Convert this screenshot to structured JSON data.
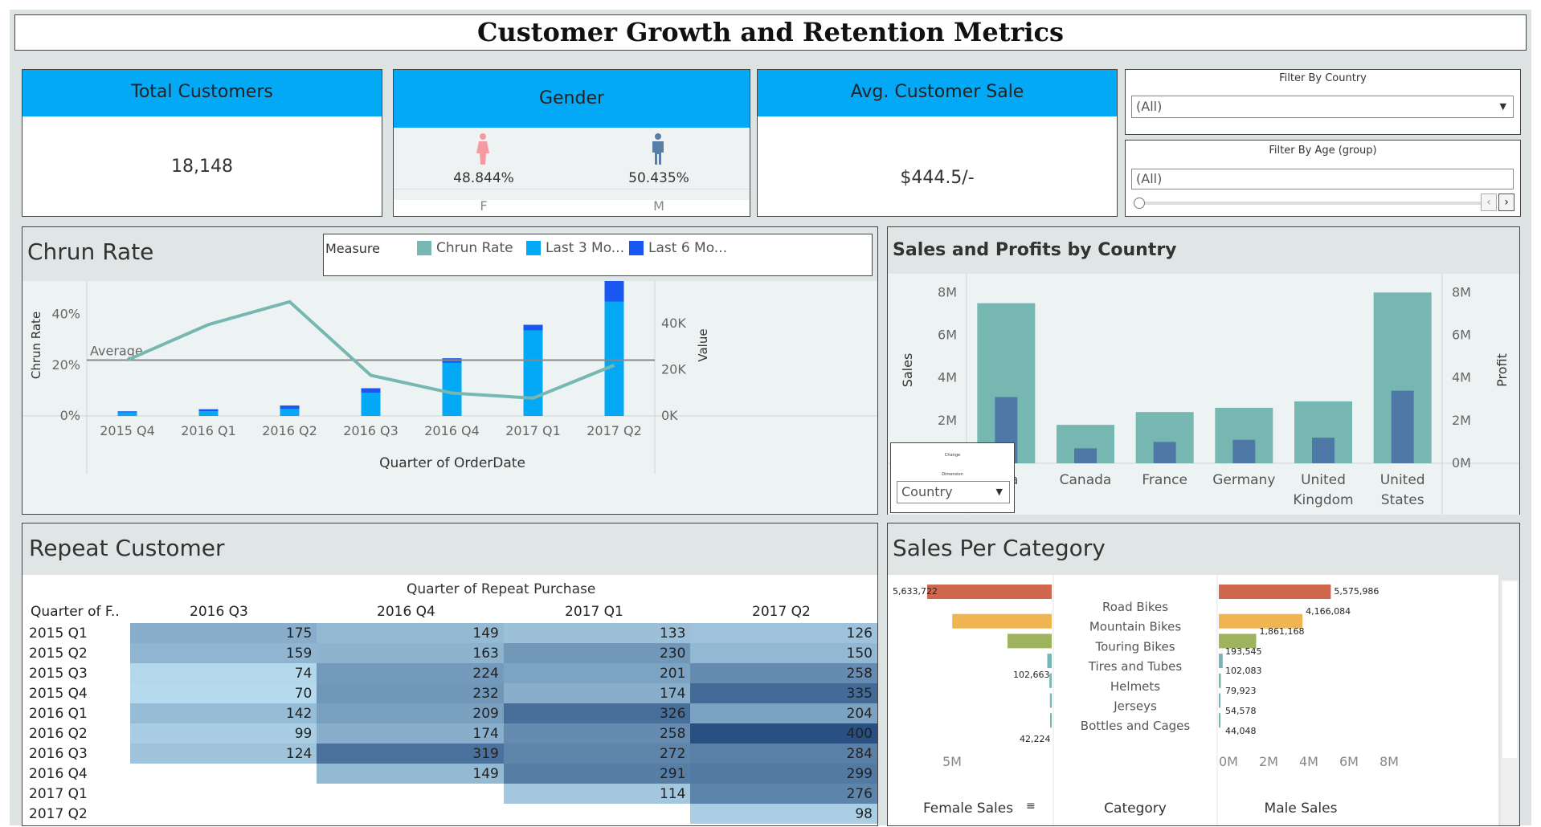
{
  "title": "Customer Growth and Retention Metrics",
  "kpis": {
    "total_customers": {
      "label": "Total Customers",
      "value": "18,148"
    },
    "gender": {
      "label": "Gender",
      "female_pct": "48.844%",
      "male_pct": "50.435%",
      "female_code": "F",
      "male_code": "M",
      "female_icon": "female-person-icon",
      "male_icon": "male-person-icon"
    },
    "avg_sale": {
      "label": "Avg. Customer Sale",
      "value": "$444.5/-"
    }
  },
  "filters": {
    "country": {
      "label": "Filter By Country",
      "value": "(All)"
    },
    "age": {
      "label": "Filter By Age (group)",
      "value": "(All)"
    }
  },
  "colors": {
    "accent": "#03a9f4",
    "teal": "#76b7b2",
    "last3": "#03a9f4",
    "last6": "#1a56f0",
    "dark_blue": "#4e79a7",
    "road": "#d0684f",
    "mountain": "#f0b550",
    "touring": "#9fb35f"
  },
  "churn": {
    "title": "Chrun Rate",
    "legend_title": "Measure",
    "legend": [
      "Chrun Rate",
      "Last 3 Mo...",
      "Last 6 Mo..."
    ],
    "average_label": "Average",
    "y_left_label": "Chrun Rate",
    "y_right_label": "Value",
    "x_label": "Quarter of OrderDate",
    "left_ticks": [
      "40%",
      "20%",
      "0%"
    ],
    "right_ticks": [
      "40K",
      "20K",
      "0K"
    ]
  },
  "sales_country": {
    "title": "Sales and Profits by Country",
    "y_left_label": "Sales",
    "y_right_label": "Profit",
    "left_ticks": [
      "8M",
      "6M",
      "4M",
      "2M"
    ],
    "right_ticks": [
      "8M",
      "6M",
      "4M",
      "2M",
      "0M"
    ],
    "x_labels": [
      "alia",
      "Canada",
      "France",
      "Germany",
      "United Kingdom",
      "United States"
    ],
    "popup": {
      "line1": "Change",
      "line2": "Dimension",
      "value": "Country"
    }
  },
  "repeat": {
    "title": "Repeat Customer",
    "col_title": "Quarter of Repeat Purchase",
    "row_header": "Quarter of F..",
    "columns": [
      "2016 Q3",
      "2016 Q4",
      "2017 Q1",
      "2017 Q2"
    ],
    "rows": [
      {
        "label": "2015 Q1",
        "cells": [
          "175",
          "149",
          "133",
          "126"
        ]
      },
      {
        "label": "2015 Q2",
        "cells": [
          "159",
          "163",
          "230",
          "150"
        ]
      },
      {
        "label": "2015 Q3",
        "cells": [
          "74",
          "224",
          "201",
          "258"
        ]
      },
      {
        "label": "2015 Q4",
        "cells": [
          "70",
          "232",
          "174",
          "335"
        ]
      },
      {
        "label": "2016 Q1",
        "cells": [
          "142",
          "209",
          "326",
          "204"
        ]
      },
      {
        "label": "2016 Q2",
        "cells": [
          "99",
          "174",
          "258",
          "400"
        ]
      },
      {
        "label": "2016 Q3",
        "cells": [
          "124",
          "319",
          "272",
          "284"
        ]
      },
      {
        "label": "2016 Q4",
        "cells": [
          "",
          "149",
          "291",
          "299"
        ]
      },
      {
        "label": "2017 Q1",
        "cells": [
          "",
          "",
          "114",
          "276"
        ]
      },
      {
        "label": "2017 Q2",
        "cells": [
          "",
          "",
          "",
          "98"
        ]
      }
    ]
  },
  "category": {
    "title": "Sales Per Category",
    "female_label": "Female Sales",
    "category_label": "Category",
    "male_label": "Male Sales",
    "female_axis_tick": "5M",
    "male_axis_ticks": [
      "0M",
      "2M",
      "4M",
      "6M",
      "8M"
    ],
    "categories": [
      "Road Bikes",
      "Mountain Bikes",
      "Touring Bikes",
      "Tires and Tubes",
      "Helmets",
      "Jerseys",
      "Bottles and Cages"
    ],
    "female_labels": [
      "5,633,722",
      "102,663",
      "42,224"
    ],
    "male_labels": [
      "5,575,986",
      "4,166,084",
      "1,861,168",
      "193,545",
      "102,083",
      "79,923",
      "54,578",
      "44,048"
    ]
  },
  "chart_data": [
    {
      "type": "line",
      "title": "Chrun Rate",
      "xlabel": "Quarter of OrderDate",
      "ylabel": "Chrun Rate",
      "y2label": "Value",
      "x": [
        "2015 Q4",
        "2016 Q1",
        "2016 Q2",
        "2016 Q3",
        "2016 Q4",
        "2017 Q1",
        "2017 Q2"
      ],
      "ylim": [
        0,
        50
      ],
      "y2lim": [
        0,
        55000
      ],
      "average": 22,
      "series": [
        {
          "name": "Chrun Rate",
          "kind": "line",
          "axis": "left",
          "values": [
            22,
            36,
            45,
            16,
            9,
            7,
            20
          ]
        },
        {
          "name": "Last 3 Mo...",
          "kind": "bar",
          "axis": "right",
          "values": [
            1500,
            2000,
            3000,
            10000,
            23000,
            37000,
            49500
          ]
        },
        {
          "name": "Last 6 Mo...",
          "kind": "bar",
          "axis": "right",
          "values": [
            500,
            900,
            1500,
            2000,
            2000,
            2500,
            11000
          ]
        }
      ]
    },
    {
      "type": "bar",
      "title": "Sales and Profits by Country",
      "categories": [
        "Australia",
        "Canada",
        "France",
        "Germany",
        "United Kingdom",
        "United States"
      ],
      "ylabel": "Sales",
      "y2label": "Profit",
      "ylim": [
        0,
        8500000
      ],
      "series": [
        {
          "name": "Sales",
          "values": [
            7500000,
            1800000,
            2400000,
            2600000,
            2900000,
            8000000
          ]
        },
        {
          "name": "Profit",
          "values": [
            3100000,
            700000,
            1000000,
            1100000,
            1200000,
            3400000
          ]
        }
      ]
    },
    {
      "type": "bar",
      "title": "Sales Per Category",
      "categories": [
        "Road Bikes",
        "Mountain Bikes",
        "Touring Bikes",
        "Tires and Tubes",
        "Helmets",
        "Jerseys",
        "Bottles and Cages"
      ],
      "series": [
        {
          "name": "Female Sales",
          "values": [
            5633722,
            4500000,
            2000000,
            200000,
            102663,
            80000,
            42224
          ]
        },
        {
          "name": "Male Sales",
          "values": [
            5575986,
            4166084,
            1861168,
            193545,
            102083,
            79923,
            54578
          ]
        }
      ],
      "xlim": [
        0,
        8000000
      ]
    },
    {
      "type": "heatmap",
      "title": "Repeat Customer",
      "x": [
        "2016 Q3",
        "2016 Q4",
        "2017 Q1",
        "2017 Q2"
      ],
      "y": [
        "2015 Q1",
        "2015 Q2",
        "2015 Q3",
        "2015 Q4",
        "2016 Q1",
        "2016 Q2",
        "2016 Q3",
        "2016 Q4",
        "2017 Q1",
        "2017 Q2"
      ],
      "values": [
        [
          175,
          149,
          133,
          126
        ],
        [
          159,
          163,
          230,
          150
        ],
        [
          74,
          224,
          201,
          258
        ],
        [
          70,
          232,
          174,
          335
        ],
        [
          142,
          209,
          326,
          204
        ],
        [
          99,
          174,
          258,
          400
        ],
        [
          124,
          319,
          272,
          284
        ],
        [
          null,
          149,
          291,
          299
        ],
        [
          null,
          null,
          114,
          276
        ],
        [
          null,
          null,
          null,
          98
        ]
      ]
    }
  ]
}
